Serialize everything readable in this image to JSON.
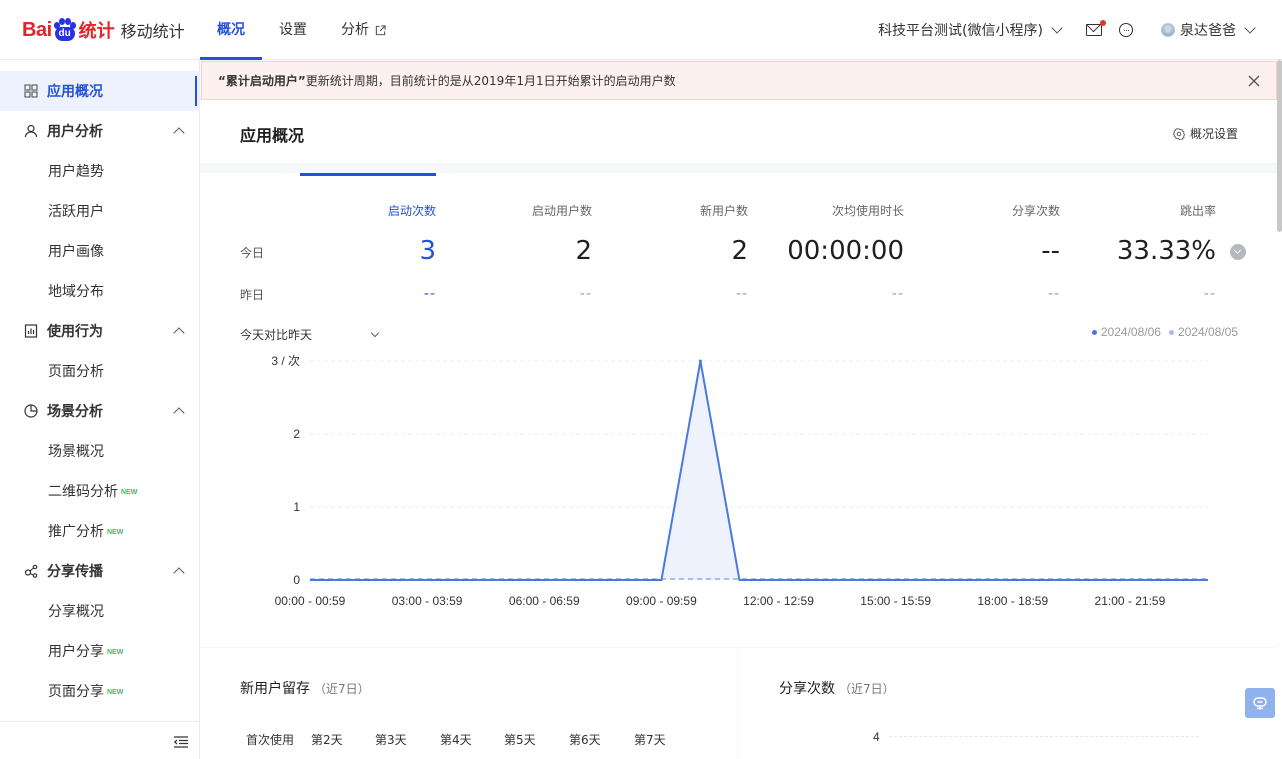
{
  "brand": {
    "logo_left": "Bai",
    "logo_paw": "du",
    "logo_right": "统计",
    "product": "移动统计"
  },
  "nav": {
    "tabs": [
      {
        "label": "概况",
        "active": true
      },
      {
        "label": "设置",
        "active": false
      },
      {
        "label": "分析",
        "active": false,
        "icon": "external-link-icon"
      }
    ]
  },
  "header": {
    "app_name": "科技平台测试(微信小程序)",
    "user_name": "泉达爸爸",
    "icons": [
      "mail-icon",
      "more-icon"
    ]
  },
  "sidebar": {
    "items": [
      {
        "label": "应用概况",
        "type": "group",
        "active": true,
        "icon": "grid-icon"
      },
      {
        "label": "用户分析",
        "type": "group",
        "icon": "user-icon"
      },
      {
        "label": "用户趋势",
        "type": "sub"
      },
      {
        "label": "活跃用户",
        "type": "sub"
      },
      {
        "label": "用户画像",
        "type": "sub"
      },
      {
        "label": "地域分布",
        "type": "sub"
      },
      {
        "label": "使用行为",
        "type": "group",
        "icon": "bar-chart-icon"
      },
      {
        "label": "页面分析",
        "type": "sub"
      },
      {
        "label": "场景分析",
        "type": "group",
        "icon": "pie-icon"
      },
      {
        "label": "场景概况",
        "type": "sub"
      },
      {
        "label": "二维码分析",
        "type": "sub",
        "new": true
      },
      {
        "label": "推广分析",
        "type": "sub",
        "new": true
      },
      {
        "label": "分享传播",
        "type": "group",
        "icon": "share-icon"
      },
      {
        "label": "分享概况",
        "type": "sub"
      },
      {
        "label": "用户分享",
        "type": "sub",
        "new": true
      },
      {
        "label": "页面分享",
        "type": "sub",
        "new": true
      }
    ],
    "new_tag": "NEW"
  },
  "notice": {
    "bold": "“累计启动用户”",
    "text": "更新统计周期，目前统计的是从2019年1月1日开始累计的启动用户数"
  },
  "panel": {
    "title": "应用概况",
    "settings_label": "概况设置"
  },
  "metrics": {
    "today_label": "今日",
    "yesterday_label": "昨日",
    "columns": [
      {
        "name": "启动次数",
        "today": "3",
        "yesterday": "--",
        "active": true
      },
      {
        "name": "启动用户数",
        "today": "2",
        "yesterday": "--"
      },
      {
        "name": "新用户数",
        "today": "2",
        "yesterday": "--"
      },
      {
        "name": "次均使用时长",
        "today": "00:00:00",
        "yesterday": "--"
      },
      {
        "name": "分享次数",
        "today": "--",
        "yesterday": "--"
      },
      {
        "name": "跳出率",
        "today": "33.33%",
        "yesterday": "--"
      }
    ]
  },
  "compare": {
    "label": "今天对比昨天"
  },
  "colors": {
    "accent": "#2650d8",
    "line_today": "#4a78e0",
    "line_yesterday": "#a9bdf0",
    "fill_today": "#edf2fc"
  },
  "chart_data": {
    "type": "area",
    "y_unit_label": "3 / 次",
    "ylim": [
      0,
      3
    ],
    "y_ticks": [
      "0",
      "1",
      "2"
    ],
    "x_tick_labels": [
      "00:00 - 00:59",
      "03:00 - 03:59",
      "06:00 - 06:59",
      "09:00 - 09:59",
      "12:00 - 12:59",
      "15:00 - 15:59",
      "18:00 - 18:59",
      "21:00 - 21:59"
    ],
    "x": [
      "00:00 - 00:59",
      "01:00 - 01:59",
      "02:00 - 02:59",
      "03:00 - 03:59",
      "04:00 - 04:59",
      "05:00 - 05:59",
      "06:00 - 06:59",
      "07:00 - 07:59",
      "08:00 - 08:59",
      "09:00 - 09:59",
      "10:00 - 10:59",
      "11:00 - 11:59",
      "12:00 - 12:59",
      "13:00 - 13:59",
      "14:00 - 14:59",
      "15:00 - 15:59",
      "16:00 - 16:59",
      "17:00 - 17:59",
      "18:00 - 18:59",
      "19:00 - 19:59",
      "20:00 - 20:59",
      "21:00 - 21:59",
      "22:00 - 22:59",
      "23:00 - 23:59"
    ],
    "series": [
      {
        "name": "2024/08/06",
        "values": [
          0,
          0,
          0,
          0,
          0,
          0,
          0,
          0,
          0,
          0,
          3,
          0,
          0,
          0,
          0,
          0,
          0,
          0,
          0,
          0,
          0,
          0,
          0,
          0
        ]
      },
      {
        "name": "2024/08/05",
        "values": [
          0,
          0,
          0,
          0,
          0,
          0,
          0,
          0,
          0,
          0,
          0,
          0,
          0,
          0,
          0,
          0,
          0,
          0,
          0,
          0,
          0,
          0,
          0,
          0
        ]
      }
    ],
    "grid": true,
    "legend_position": "top-right"
  },
  "retention": {
    "title": "新用户留存",
    "subtitle": "（近7日）",
    "columns": [
      "首次使用",
      "第2天",
      "第3天",
      "第4天",
      "第5天",
      "第6天",
      "第7天"
    ]
  },
  "share_count": {
    "title": "分享次数",
    "subtitle": "（近7日）",
    "y_top_tick": "4"
  }
}
